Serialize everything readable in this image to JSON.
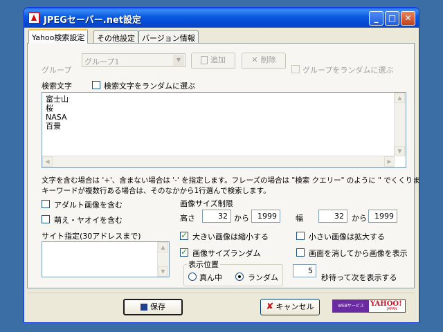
{
  "window": {
    "title": "JPEGセーバー.net設定"
  },
  "tabs": [
    {
      "label": "Yahoo検索設定"
    },
    {
      "label": "その他設定"
    },
    {
      "label": "バージョン情報"
    }
  ],
  "group": {
    "label": "グループ",
    "selected": "グループ1",
    "add_label": "追加",
    "delete_label": "削除",
    "random_group_label": "グループをランダムに選ぶ"
  },
  "search": {
    "label": "検索文字",
    "random_label": "検索文字をランダムに選ぶ",
    "lines": [
      "富士山",
      "桜",
      "NASA",
      "百景"
    ],
    "help_line1": "文字を含む場合は '+'、含まない場合は '-' を指定します。フレーズの場合は \"検索 クエリー\" のように \" でくくります。",
    "help_line2": "キーワードが複数行ある場合は、そのなかから1行選んで検索します。"
  },
  "filters": {
    "adult_label": "アダルト画像を含む",
    "moe_label": "萌え・ヤオイを含む"
  },
  "site": {
    "label": "サイト指定(30アドレスまで)"
  },
  "size": {
    "title": "画像サイズ制限",
    "height_label": "高さ",
    "height_min": "32",
    "height_max": "1999",
    "width_label": "幅",
    "width_min": "32",
    "width_max": "1999",
    "from_label": "から",
    "shrink_label": "大きい画像は縮小する",
    "enlarge_label": "小さい画像は拡大する",
    "random_size_label": "画像サイズランダム",
    "clear_screen_label": "画面を消してから画像を表示"
  },
  "position": {
    "title": "表示位置",
    "center_label": "真ん中",
    "random_label": "ランダム",
    "selected": "random"
  },
  "wait": {
    "seconds": "5",
    "suffix": "秒待って次を表示する"
  },
  "footer": {
    "save_label": "保存",
    "cancel_label": "キャンセル",
    "yahoo_small": "WEBサービス",
    "yahoo_logo": "YAHOO!",
    "yahoo_japan": "JAPAN"
  },
  "colors": {
    "titlebar": "#0a5ae0",
    "accent_tab": "#ffc83c",
    "yahoo_purple": "#6a2aa0"
  }
}
